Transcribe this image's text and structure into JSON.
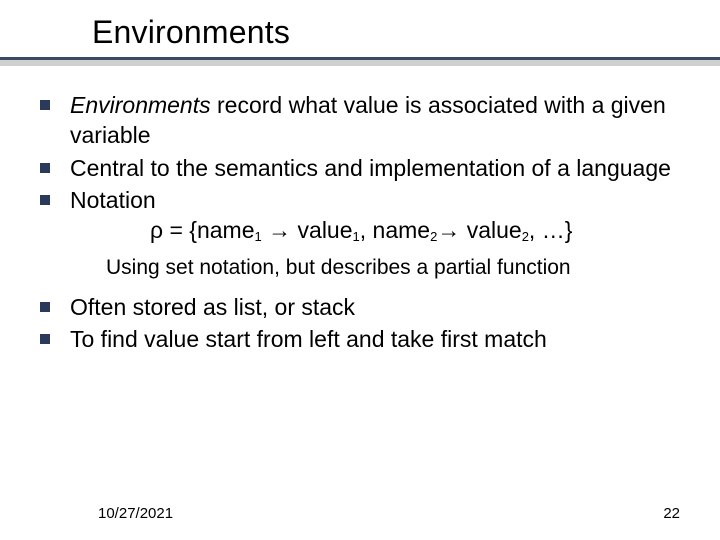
{
  "title": "Environments",
  "bullets": {
    "b1_lead": "Environments",
    "b1_rest": " record what value is associated with a given variable",
    "b2": "Central to the semantics and implementation of a language",
    "b3": "Notation",
    "notation_rho": "ρ = {name",
    "notation_s1": "1",
    "notation_arrow1": " → value",
    "notation_s1b": "1",
    "notation_mid": ", name",
    "notation_s2": "2",
    "notation_arrow2": "→ value",
    "notation_s2b": "2",
    "notation_end": ", …}",
    "note": "Using set notation, but describes a partial function",
    "b4": "Often stored as list, or stack",
    "b5": "To find value start from left and take first match"
  },
  "footer": {
    "date": "10/27/2021",
    "page": "22"
  }
}
